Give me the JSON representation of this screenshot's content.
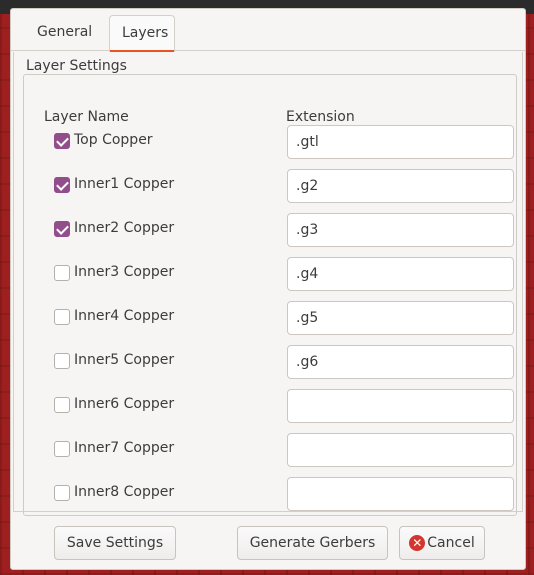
{
  "tabs": [
    {
      "label": "General",
      "active": false
    },
    {
      "label": "Layers",
      "active": true
    }
  ],
  "group_title": "Layer Settings",
  "columns": {
    "name": "Layer Name",
    "extension": "Extension"
  },
  "layers": [
    {
      "label": "Top Copper",
      "checked": true,
      "extension": ".gtl"
    },
    {
      "label": "Inner1 Copper",
      "checked": true,
      "extension": ".g2"
    },
    {
      "label": "Inner2 Copper",
      "checked": true,
      "extension": ".g3"
    },
    {
      "label": "Inner3 Copper",
      "checked": false,
      "extension": ".g4"
    },
    {
      "label": "Inner4 Copper",
      "checked": false,
      "extension": ".g5"
    },
    {
      "label": "Inner5 Copper",
      "checked": false,
      "extension": ".g6"
    },
    {
      "label": "Inner6 Copper",
      "checked": false,
      "extension": ""
    },
    {
      "label": "Inner7 Copper",
      "checked": false,
      "extension": ""
    },
    {
      "label": "Inner8 Copper",
      "checked": false,
      "extension": ""
    }
  ],
  "buttons": {
    "save": "Save Settings",
    "generate": "Generate Gerbers",
    "cancel": "Cancel"
  },
  "icons": {
    "cancel": "cancel-circle-icon"
  },
  "colors": {
    "accent": "#e95420",
    "checkbox": "#924d8b",
    "cancel_icon": "#d3362f"
  }
}
